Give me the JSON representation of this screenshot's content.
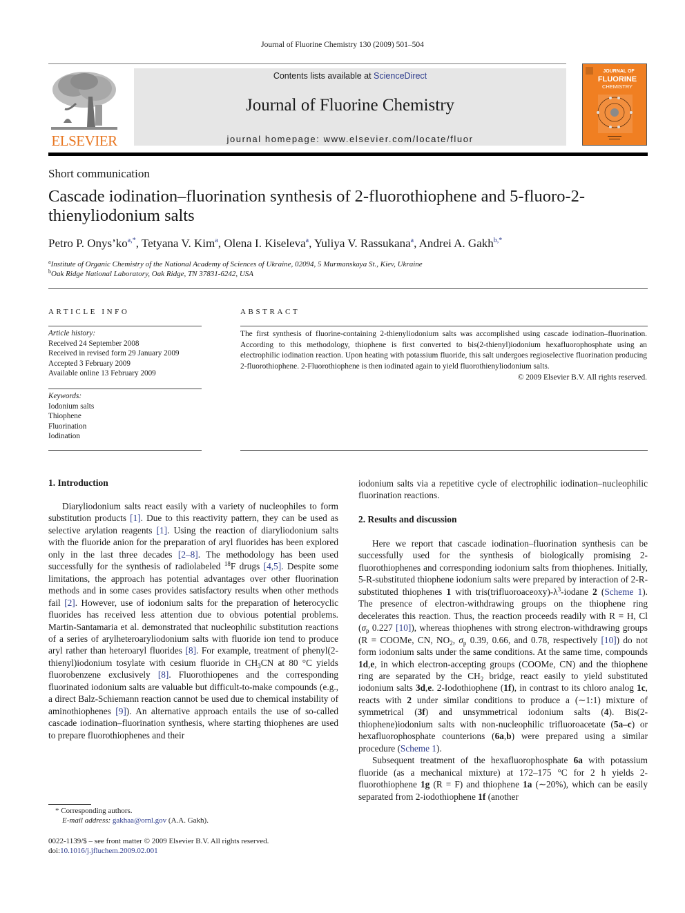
{
  "running_head": "Journal of Fluorine Chemistry 130 (2009) 501–504",
  "masthead": {
    "contents_prefix": "Contents lists available at ",
    "contents_link": "ScienceDirect",
    "journal_title": "Journal of Fluorine Chemistry",
    "homepage": "journal homepage: www.elsevier.com/locate/fluor",
    "publisher_logo_text": "ELSEVIER",
    "cover": {
      "line1": "JOURNAL OF",
      "line2": "FLUORINE",
      "line3": "CHEMISTRY",
      "color": "#f07f22"
    }
  },
  "article": {
    "type": "Short communication",
    "title": "Cascade iodination–fluorination synthesis of 2-fluorothiophene and 5-fluoro-2-thienyliodonium salts",
    "authors": [
      {
        "name": "Petro P. Onys’ko",
        "sup": "a,*"
      },
      {
        "name": "Tetyana V. Kim",
        "sup": "a"
      },
      {
        "name": "Olena I. Kiseleva",
        "sup": "a"
      },
      {
        "name": "Yuliya V. Rassukana",
        "sup": "a"
      },
      {
        "name": "Andrei A. Gakh",
        "sup": "b,*"
      }
    ],
    "affiliations": [
      {
        "mark": "a",
        "text": "Institute of Organic Chemistry of the National Academy of Sciences of Ukraine, 02094, 5 Murmanskaya St., Kiev, Ukraine"
      },
      {
        "mark": "b",
        "text": "Oak Ridge National Laboratory, Oak Ridge, TN 37831-6242, USA"
      }
    ]
  },
  "article_info": {
    "heading": "ARTICLE INFO",
    "history_label": "Article history:",
    "history": [
      "Received 24 September 2008",
      "Received in revised form 29 January 2009",
      "Accepted 3 February 2009",
      "Available online 13 February 2009"
    ],
    "keywords_label": "Keywords:",
    "keywords": [
      "Iodonium salts",
      "Thiophene",
      "Fluorination",
      "Iodination"
    ]
  },
  "abstract": {
    "heading": "ABSTRACT",
    "text": "The first synthesis of fluorine-containing 2-thienyliodonium salts was accomplished using cascade iodination–fluorination. According to this methodology, thiophene is first converted to bis(2-thienyl)iodonium hexafluorophosphate using an electrophilic iodination reaction. Upon heating with potassium fluoride, this salt undergoes regioselective fluorination producing 2-fluorothiophene. 2-Fluorothiophene is then iodinated again to yield fluorothienyliodonium salts.",
    "copyright": "© 2009 Elsevier B.V. All rights reserved."
  },
  "sections": {
    "intro_heading": "1.  Introduction",
    "results_heading": "2.  Results and discussion"
  },
  "footnotes": {
    "corresponding": "*  Corresponding authors.",
    "email_label": "E-mail address: ",
    "email": "gakhaa@ornl.gov",
    "email_suffix": " (A.A. Gakh).",
    "front_matter": "0022-1139/$ – see front matter © 2009 Elsevier B.V. All rights reserved.",
    "doi_prefix": "doi:",
    "doi": "10.1016/j.jfluchem.2009.02.001"
  },
  "colors": {
    "link": "#2b3a8c",
    "elsevier_orange": "#e87722",
    "masthead_bg": "#e6e6e6"
  }
}
